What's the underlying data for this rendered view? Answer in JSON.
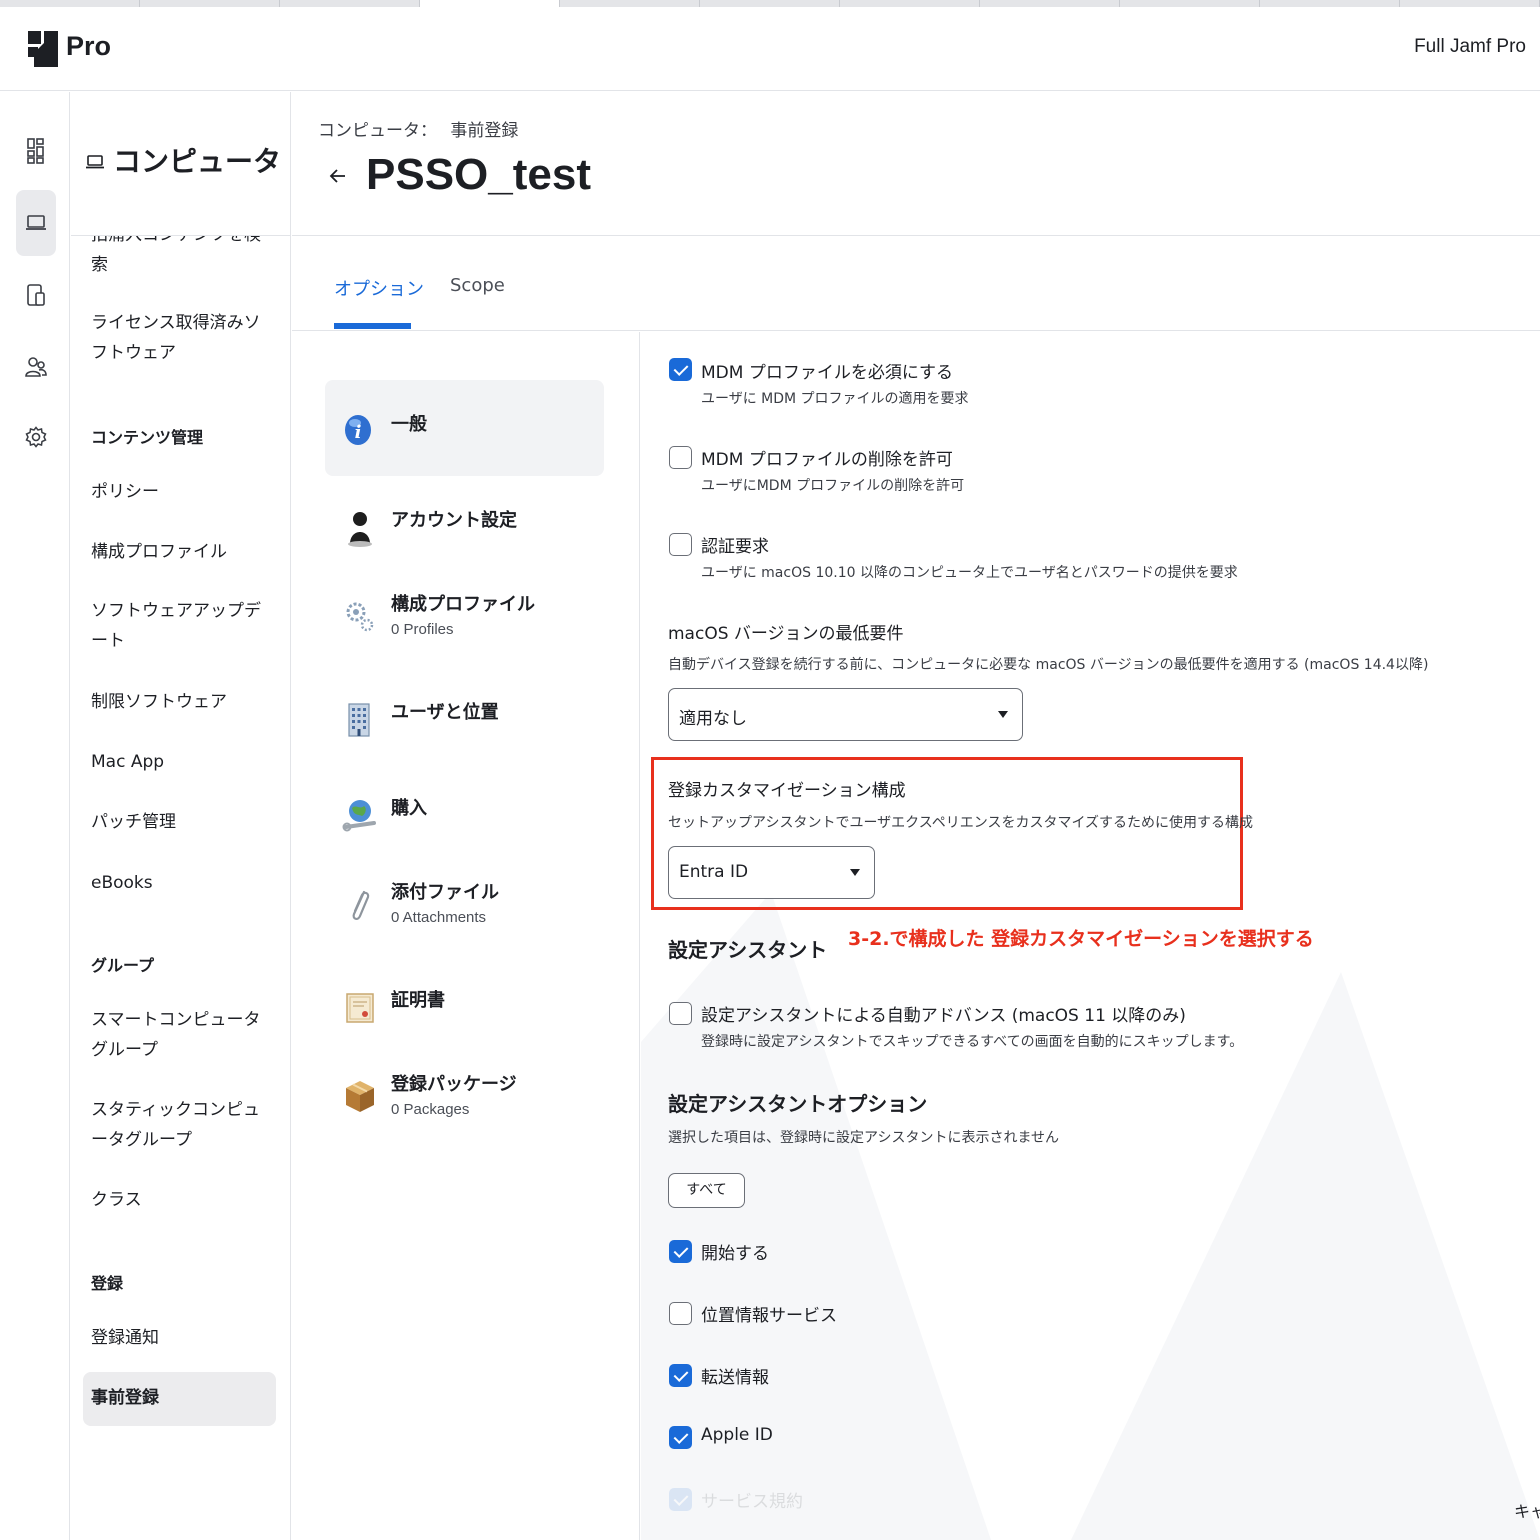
{
  "app": {
    "product": "Pro",
    "instance": "Full Jamf Pro"
  },
  "sidebar": {
    "title": "コンピュータ",
    "items": [
      {
        "label": "拍痛入コンテンツを検索"
      },
      {
        "label": "ライセンス取得済みソフトウェア"
      }
    ],
    "groups": [
      {
        "title": "コンテンツ管理",
        "items": [
          "ポリシー",
          "構成プロファイル",
          "ソフトウェアアップデート",
          "制限ソフトウェア",
          "Mac App",
          "パッチ管理",
          "eBooks"
        ]
      },
      {
        "title": "グループ",
        "items": [
          "スマートコンピュータグループ",
          "スタティックコンピュータグループ",
          "クラス"
        ]
      },
      {
        "title": "登録",
        "items": [
          "登録通知",
          "事前登録"
        ]
      }
    ]
  },
  "header": {
    "breadcrumb_parent": "コンピュータ：",
    "breadcrumb_current": "事前登録",
    "title": "PSSO_test"
  },
  "tabs": [
    {
      "label": "オプション",
      "active": true
    },
    {
      "label": "Scope",
      "active": false
    }
  ],
  "categories": [
    {
      "label": "一般",
      "sub": "",
      "icon": "info-icon"
    },
    {
      "label": "アカウント設定",
      "sub": "",
      "icon": "user-silhouette-icon"
    },
    {
      "label": "構成プロファイル",
      "sub": "0 Profiles",
      "icon": "gears-icon"
    },
    {
      "label": "ユーザと位置",
      "sub": "",
      "icon": "building-icon"
    },
    {
      "label": "購入",
      "sub": "",
      "icon": "globe-wrench-icon"
    },
    {
      "label": "添付ファイル",
      "sub": "0 Attachments",
      "icon": "paperclip-icon"
    },
    {
      "label": "証明書",
      "sub": "",
      "icon": "certificate-icon"
    },
    {
      "label": "登録パッケージ",
      "sub": "0 Packages",
      "icon": "package-icon"
    }
  ],
  "options": {
    "mdm_required": {
      "label": "MDM プロファイルを必須にする",
      "desc": "ユーザに MDM プロファイルの適用を要求",
      "checked": true
    },
    "mdm_removal": {
      "label": "MDM プロファイルの削除を許可",
      "desc": "ユーザにMDM プロファイルの削除を許可",
      "checked": false
    },
    "auth_required": {
      "label": "認証要求",
      "desc": "ユーザに macOS 10.10 以降のコンピュータ上でユーザ名とパスワードの提供を要求",
      "checked": false
    }
  },
  "macos_min": {
    "label": "macOS バージョンの最低要件",
    "desc": "自動デバイス登録を続行する前に、コンピュータに必要な macOS バージョンの最低要件を適用する (macOS 14.4以降)",
    "value": "適用なし"
  },
  "enrollment_customization": {
    "label": "登録カスタマイゼーション構成",
    "desc": "セットアップアシスタントでユーザエクスペリエンスをカスタマイズするために使用する構成",
    "value": "Entra ID"
  },
  "annotation": "3-2.で構成した 登録カスタマイゼーションを選択する",
  "setup_assistant": {
    "title": "設定アシスタント",
    "auto_advance": {
      "label": "設定アシスタントによる自動アドバンス (macOS 11 以降のみ)",
      "desc": "登録時に設定アシスタントでスキップできるすべての画面を自動的にスキップします。",
      "checked": false
    }
  },
  "setup_options": {
    "title": "設定アシスタントオプション",
    "desc": "選択した項目は、登録時に設定アシスタントに表示されません",
    "all_button": "すべて",
    "items": [
      {
        "label": "開始する",
        "checked": true
      },
      {
        "label": "位置情報サービス",
        "checked": false
      },
      {
        "label": "転送情報",
        "checked": true
      },
      {
        "label": "Apple ID",
        "checked": true
      },
      {
        "label": "サービス規約",
        "checked": true
      }
    ]
  },
  "footer_partial": "キャ",
  "colors": {
    "accent": "#1a6ad8",
    "annotation": "#e8301d"
  }
}
